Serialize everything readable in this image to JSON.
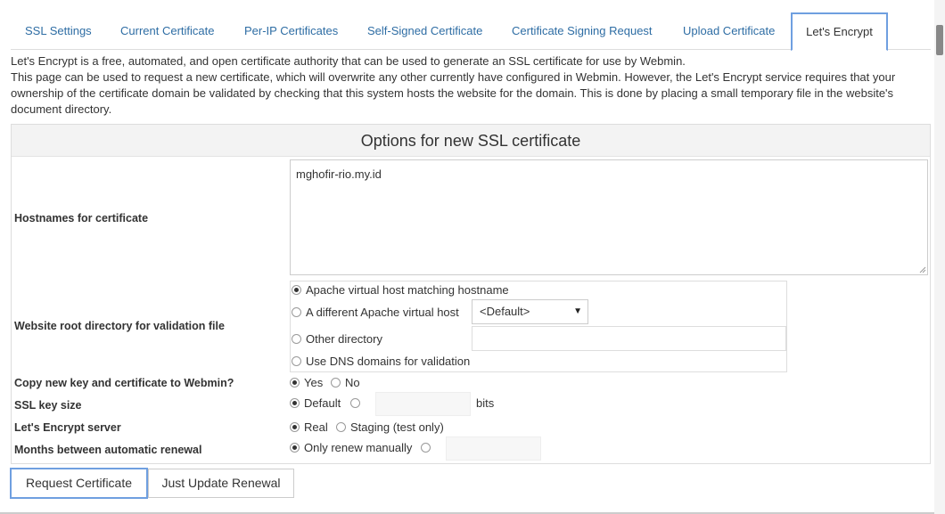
{
  "tabs": [
    {
      "label": "SSL Settings",
      "active": false
    },
    {
      "label": "Current Certificate",
      "active": false
    },
    {
      "label": "Per-IP Certificates",
      "active": false
    },
    {
      "label": "Self-Signed Certificate",
      "active": false
    },
    {
      "label": "Certificate Signing Request",
      "active": false
    },
    {
      "label": "Upload Certificate",
      "active": false
    },
    {
      "label": "Let's Encrypt",
      "active": true
    }
  ],
  "intro": {
    "line1": "Let's Encrypt is a free, automated, and open certificate authority that can be used to generate an SSL certificate for use by Webmin.",
    "line2": "This page can be used to request a new certificate, which will overwrite any other currently have configured in Webmin. However, the Let's Encrypt service requires that your ownership of the certificate domain be validated by checking that this system hosts the website for the domain. This is done by placing a small temporary file in the website's document directory."
  },
  "panel": {
    "title": "Options for new SSL certificate"
  },
  "hostnames": {
    "label": "Hostnames for certificate",
    "value": "mghofir-rio.my.id"
  },
  "webroot": {
    "label": "Website root directory for validation file",
    "options": [
      {
        "label": "Apache virtual host matching hostname",
        "checked": true
      },
      {
        "label": "A different Apache virtual host",
        "checked": false
      },
      {
        "label": "Other directory",
        "checked": false
      },
      {
        "label": "Use DNS domains for validation",
        "checked": false
      }
    ],
    "vhost_select": "<Default>",
    "other_dir_value": ""
  },
  "copy_webmin": {
    "label": "Copy new key and certificate to Webmin?",
    "yes": "Yes",
    "no": "No",
    "selected": "Yes"
  },
  "key_size": {
    "label": "SSL key size",
    "default": "Default",
    "unit": "bits",
    "value": ""
  },
  "server": {
    "label": "Let's Encrypt server",
    "real": "Real",
    "staging": "Staging (test only)",
    "selected": "Real"
  },
  "renewal": {
    "label": "Months between automatic renewal",
    "manual": "Only renew manually",
    "value": ""
  },
  "buttons": {
    "request": "Request Certificate",
    "update": "Just Update Renewal"
  }
}
